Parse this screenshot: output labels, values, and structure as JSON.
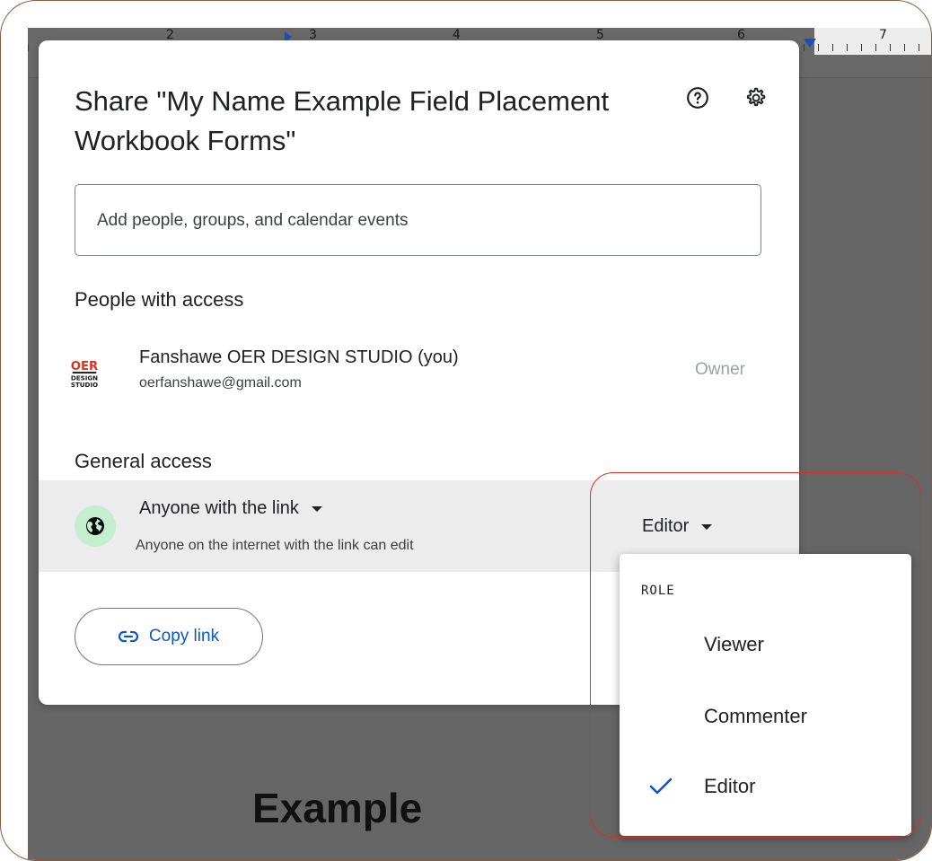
{
  "ruler": {
    "numbers": [
      "2",
      "3",
      "4",
      "5",
      "6",
      "7"
    ]
  },
  "document": {
    "visible_text": "Example"
  },
  "dialog": {
    "title": "Share \"My Name Example Field Placement Workbook Forms\"",
    "help_icon": "help-circle-icon",
    "settings_icon": "gear-icon",
    "search": {
      "placeholder": "Add people, groups, and calendar events",
      "value": ""
    },
    "people_section_label": "People with access",
    "owner": {
      "name": "Fanshawe OER DESIGN STUDIO (you)",
      "email": "oerfanshawe@gmail.com",
      "role": "Owner",
      "avatar_text": [
        "OER",
        "DESIGN",
        "STUDIO"
      ]
    },
    "general_section_label": "General access",
    "general_access": {
      "scope": "Anyone with the link",
      "description": "Anyone on the internet with the link can edit",
      "role": "Editor"
    },
    "copy_link_label": "Copy link"
  },
  "role_menu": {
    "header": "ROLE",
    "items": [
      {
        "label": "Viewer",
        "selected": false
      },
      {
        "label": "Commenter",
        "selected": false
      },
      {
        "label": "Editor",
        "selected": true
      }
    ]
  },
  "colors": {
    "accent_blue": "#0b57d0",
    "globe_bg": "#c4eed0",
    "highlight_red": "#d93025",
    "backdrop": "#666666"
  }
}
